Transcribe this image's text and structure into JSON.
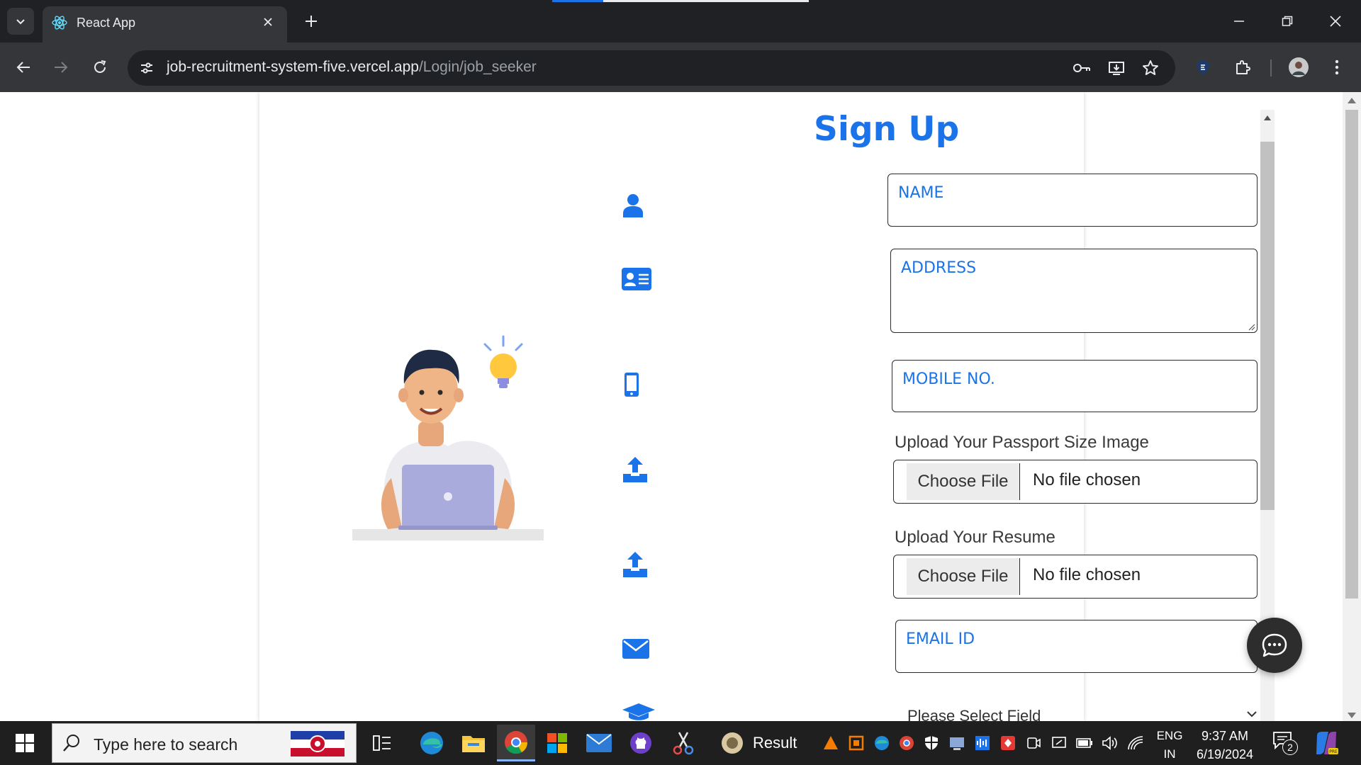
{
  "browser": {
    "tab_title": "React App",
    "url_host": "job-recruitment-system-five.vercel.app",
    "url_path": "/Login/job_seeker"
  },
  "form": {
    "title": "Sign Up",
    "name_placeholder": "NAME",
    "address_placeholder": "ADDRESS",
    "mobile_placeholder": "MOBILE NO.",
    "passport_label": "Upload Your Passport Size Image",
    "resume_label": "Upload Your Resume",
    "choose_file_label": "Choose File",
    "no_file_label": "No file chosen",
    "email_placeholder": "EMAIL ID",
    "field_select_label": "Please Select Field"
  },
  "colors": {
    "accent": "#1a73e8",
    "chrome_dark": "#202124",
    "chrome_toolbar": "#35363a"
  },
  "taskbar": {
    "search_placeholder": "Type here to search",
    "result_app_label": "Result",
    "language_line1": "ENG",
    "language_line2": "IN",
    "time": "9:37 AM",
    "date": "6/19/2024",
    "notification_count": "2"
  }
}
